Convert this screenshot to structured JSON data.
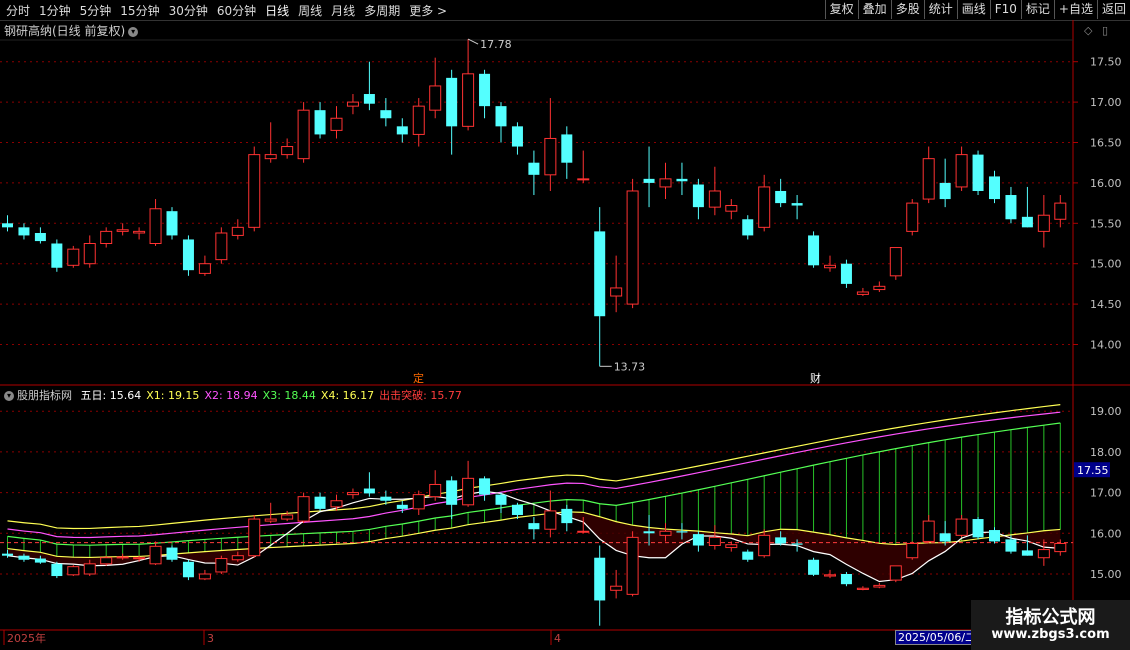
{
  "toolbar": {
    "periods": [
      "分时",
      "1分钟",
      "5分钟",
      "15分钟",
      "30分钟",
      "60分钟",
      "日线",
      "周线",
      "月线",
      "多周期",
      "更多 >"
    ],
    "active_period": "日线",
    "actions": [
      "复权",
      "叠加",
      "多股",
      "统计",
      "画线",
      "F10",
      "标记",
      "+自选",
      "返回"
    ]
  },
  "main_chart": {
    "title": "钢研高纳(日线 前复权)",
    "y_ticks": [
      "17.50",
      "17.00",
      "16.50",
      "16.00",
      "15.50",
      "15.00",
      "14.50",
      "14.00"
    ],
    "high_label": "17.78",
    "low_label": "13.73",
    "markers": [
      {
        "text": "定",
        "color": "#ff6a00"
      },
      {
        "text": "财",
        "color": "#ffffff"
      }
    ],
    "colors": {
      "up": "#ff3232",
      "down": "#54ffff"
    }
  },
  "indicator": {
    "name": "股朋指标网",
    "values": [
      {
        "label": "五日: 15.64",
        "color": "#ffffff"
      },
      {
        "label": "X1: 19.15",
        "color": "#ffff54"
      },
      {
        "label": "X2: 18.94",
        "color": "#ff54ff"
      },
      {
        "label": "X3: 18.44",
        "color": "#54ff54"
      },
      {
        "label": "X4: 16.17",
        "color": "#ffff54"
      },
      {
        "label": "出击突破: 15.77",
        "color": "#ff3c3c"
      }
    ],
    "y_ticks": [
      "19.00",
      "18.00",
      "17.00",
      "16.00",
      "15.00"
    ],
    "current_price": "17.55"
  },
  "time_axis": {
    "labels": [
      "2025年",
      "3",
      "4"
    ],
    "selected_date": "2025/05/06/二"
  },
  "watermark": {
    "line1": "指标公式网",
    "line2": "www.zbgs3.com"
  },
  "chart_data": {
    "type": "candlestick",
    "candles": [
      [
        15.5,
        15.45,
        15.6,
        15.4
      ],
      [
        15.45,
        15.35,
        15.5,
        15.3
      ],
      [
        15.38,
        15.28,
        15.45,
        15.25
      ],
      [
        15.25,
        14.95,
        15.3,
        14.9
      ],
      [
        14.98,
        15.18,
        15.22,
        14.95
      ],
      [
        15.0,
        15.25,
        15.35,
        14.95
      ],
      [
        15.25,
        15.4,
        15.45,
        15.2
      ],
      [
        15.4,
        15.42,
        15.5,
        15.35
      ],
      [
        15.38,
        15.4,
        15.45,
        15.3
      ],
      [
        15.25,
        15.68,
        15.8,
        15.22
      ],
      [
        15.65,
        15.35,
        15.7,
        15.3
      ],
      [
        15.3,
        14.92,
        15.35,
        14.85
      ],
      [
        14.88,
        15.0,
        15.1,
        14.85
      ],
      [
        15.05,
        15.38,
        15.45,
        15.0
      ],
      [
        15.35,
        15.45,
        15.55,
        15.3
      ],
      [
        15.45,
        16.35,
        16.45,
        15.4
      ],
      [
        16.3,
        16.35,
        16.75,
        16.25
      ],
      [
        16.35,
        16.45,
        16.55,
        16.3
      ],
      [
        16.3,
        16.9,
        17.0,
        16.25
      ],
      [
        16.9,
        16.6,
        17.0,
        16.55
      ],
      [
        16.65,
        16.8,
        16.95,
        16.55
      ],
      [
        16.95,
        17.0,
        17.1,
        16.85
      ],
      [
        17.1,
        16.98,
        17.5,
        16.9
      ],
      [
        16.9,
        16.8,
        17.05,
        16.7
      ],
      [
        16.7,
        16.6,
        16.8,
        16.5
      ],
      [
        16.6,
        16.95,
        17.05,
        16.45
      ],
      [
        16.9,
        17.2,
        17.55,
        16.8
      ],
      [
        17.3,
        16.7,
        17.4,
        16.35
      ],
      [
        16.7,
        17.35,
        17.78,
        16.65
      ],
      [
        17.35,
        16.95,
        17.4,
        16.8
      ],
      [
        16.95,
        16.7,
        17.0,
        16.5
      ],
      [
        16.7,
        16.45,
        16.75,
        16.35
      ],
      [
        16.25,
        16.1,
        16.4,
        15.85
      ],
      [
        16.1,
        16.55,
        17.05,
        15.9
      ],
      [
        16.6,
        16.25,
        16.7,
        16.05
      ],
      [
        16.05,
        16.05,
        16.4,
        16.0
      ],
      [
        15.4,
        14.35,
        15.7,
        13.73
      ],
      [
        14.6,
        14.7,
        15.1,
        14.4
      ],
      [
        14.5,
        15.9,
        16.05,
        14.45
      ],
      [
        16.05,
        16.0,
        16.45,
        15.7
      ],
      [
        15.95,
        16.05,
        16.25,
        15.8
      ],
      [
        16.05,
        16.02,
        16.25,
        15.85
      ],
      [
        15.98,
        15.7,
        16.05,
        15.55
      ],
      [
        15.7,
        15.9,
        16.2,
        15.6
      ],
      [
        15.65,
        15.72,
        15.8,
        15.55
      ],
      [
        15.55,
        15.35,
        15.6,
        15.3
      ],
      [
        15.45,
        15.95,
        16.1,
        15.4
      ],
      [
        15.9,
        15.75,
        16.05,
        15.7
      ],
      [
        15.75,
        15.72,
        15.85,
        15.55
      ],
      [
        15.35,
        14.98,
        15.4,
        14.95
      ],
      [
        14.95,
        14.98,
        15.1,
        14.9
      ],
      [
        15.0,
        14.75,
        15.05,
        14.7
      ],
      [
        14.62,
        14.65,
        14.7,
        14.6
      ],
      [
        14.68,
        14.72,
        14.78,
        14.65
      ],
      [
        14.85,
        15.2,
        15.2,
        14.8
      ],
      [
        15.4,
        15.75,
        15.8,
        15.35
      ],
      [
        15.8,
        16.3,
        16.45,
        15.75
      ],
      [
        16.0,
        15.8,
        16.3,
        15.7
      ],
      [
        15.95,
        16.35,
        16.45,
        15.9
      ],
      [
        16.35,
        15.9,
        16.4,
        15.85
      ],
      [
        16.08,
        15.8,
        16.15,
        15.75
      ],
      [
        15.85,
        15.55,
        15.95,
        15.5
      ],
      [
        15.58,
        15.45,
        15.95,
        15.45
      ],
      [
        15.4,
        15.6,
        15.85,
        15.2
      ],
      [
        15.55,
        15.75,
        15.85,
        15.45
      ]
    ],
    "price_axis_range": [
      13.73,
      17.78
    ],
    "indicator_axis_range": [
      15.0,
      19.0
    ]
  }
}
